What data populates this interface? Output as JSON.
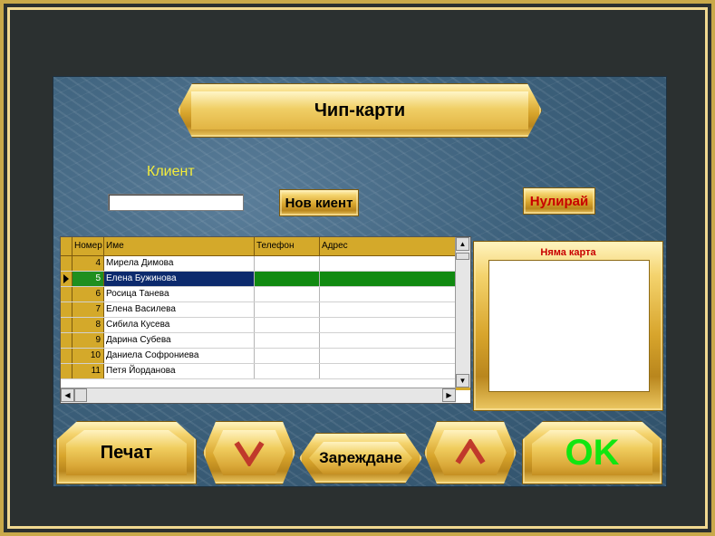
{
  "window": {
    "title": "Чип-карти"
  },
  "client": {
    "label": "Клиент",
    "value": ""
  },
  "buttons": {
    "new_client": "Нов киент",
    "reset": "Нулирай",
    "print": "Печат",
    "load": "Зареждане",
    "ok": "OK"
  },
  "icons": {
    "down": "chevron-down-icon",
    "up": "chevron-up-icon",
    "row_pointer": "triangle-right-icon"
  },
  "grid": {
    "columns": [
      "Номер",
      "Име",
      "Телефон",
      "Адрес"
    ],
    "rows": [
      {
        "num": "4",
        "name": "Мирела Димова",
        "phone": "",
        "addr": ""
      },
      {
        "num": "5",
        "name": "Елена Бужинова",
        "phone": "",
        "addr": "",
        "selected": true
      },
      {
        "num": "6",
        "name": "Росица Танева",
        "phone": "",
        "addr": ""
      },
      {
        "num": "7",
        "name": "Елена Василева",
        "phone": "",
        "addr": ""
      },
      {
        "num": "8",
        "name": "Сибила Кусева",
        "phone": "",
        "addr": ""
      },
      {
        "num": "9",
        "name": "Дарина Субева",
        "phone": "",
        "addr": ""
      },
      {
        "num": "10",
        "name": "Даниела Софрониева",
        "phone": "",
        "addr": ""
      },
      {
        "num": "11",
        "name": "Петя Йорданова",
        "phone": "",
        "addr": ""
      }
    ]
  },
  "card": {
    "status": "Няма карта"
  },
  "colors": {
    "ok_text": "#11e611",
    "chevron": "#c0392b",
    "client_label": "#f4ec3a",
    "alert_text": "#c80000"
  }
}
